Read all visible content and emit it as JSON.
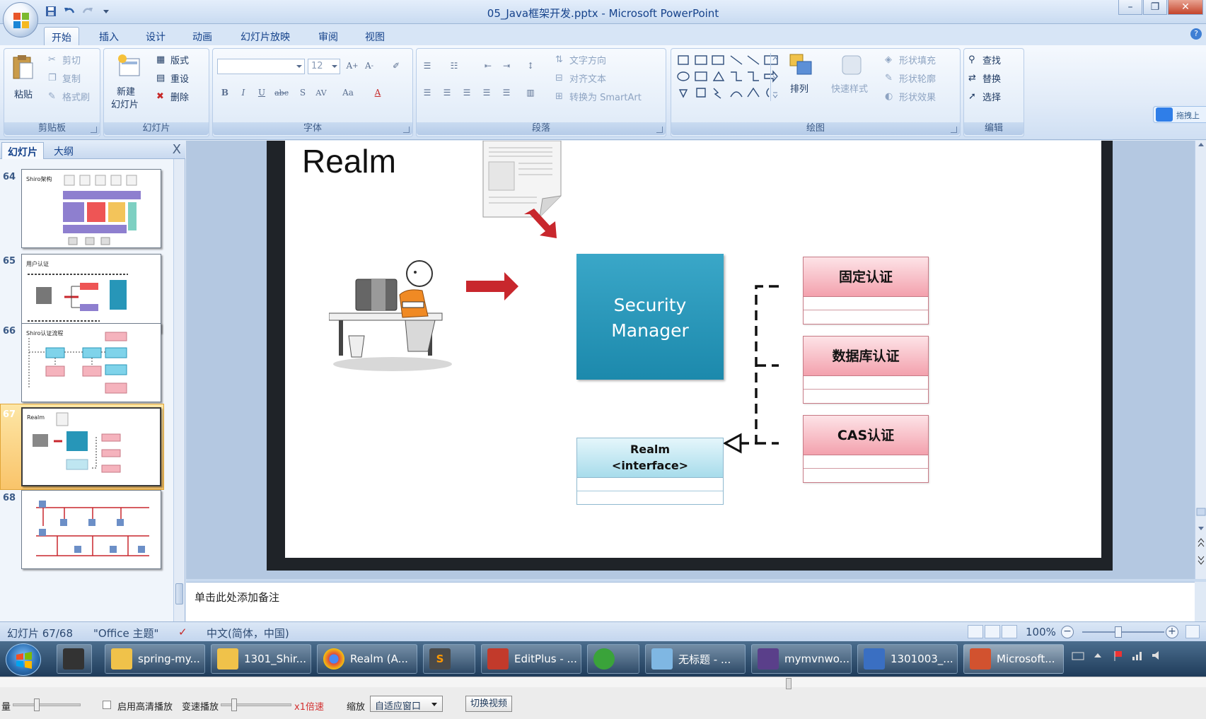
{
  "window": {
    "title": "05_Java框架开发.pptx - Microsoft PowerPoint"
  },
  "ribbon_tabs": [
    "开始",
    "插入",
    "设计",
    "动画",
    "幻灯片放映",
    "审阅",
    "视图"
  ],
  "clipboard": {
    "paste": "粘贴",
    "cut": "剪切",
    "copy": "复制",
    "format_painter": "格式刷",
    "label": "剪贴板"
  },
  "slides_group": {
    "new_slide_line1": "新建",
    "new_slide_line2": "幻灯片",
    "layout": "版式",
    "reset": "重设",
    "delete": "删除",
    "label": "幻灯片"
  },
  "font_group": {
    "font_size": "12",
    "label": "字体"
  },
  "paragraph_group": {
    "text_direction": "文字方向",
    "align_text": "对齐文本",
    "convert_smartart": "转换为 SmartArt",
    "label": "段落"
  },
  "drawing_group": {
    "arrange": "排列",
    "quick_styles": "快速样式",
    "shape_fill": "形状填充",
    "shape_outline": "形状轮廓",
    "shape_effects": "形状效果",
    "label": "绘图"
  },
  "editing_group": {
    "find": "查找",
    "replace": "替换",
    "select": "选择",
    "label": "编辑"
  },
  "side_badge": "拖拽上",
  "left_panel": {
    "tab_slides": "幻灯片",
    "tab_outline": "大纲",
    "close": "X",
    "thumbnails": [
      {
        "num": "64",
        "title": "Shiro架构"
      },
      {
        "num": "65",
        "title": "用户认证"
      },
      {
        "num": "66",
        "title": "Shiro认证流程"
      },
      {
        "num": "67",
        "title": "Realm"
      },
      {
        "num": "68",
        "title": ""
      }
    ]
  },
  "slide": {
    "title": "Realm",
    "security_manager_line1": "Security",
    "security_manager_line2": "Manager",
    "realm_line1": "Realm",
    "realm_line2": "<interface>",
    "auth_boxes": [
      "固定认证",
      "数据库认证",
      "CAS认证"
    ]
  },
  "notes": {
    "placeholder": "单击此处添加备注"
  },
  "statusbar": {
    "slide_counter": "幻灯片 67/68",
    "theme": "\"Office 主题\"",
    "language": "中文(简体，中国)",
    "zoom": "100%"
  },
  "taskbar": {
    "items": [
      {
        "label": "spring-my...",
        "color": "#f0c24a"
      },
      {
        "label": "1301_Shir...",
        "color": "#f0c24a"
      },
      {
        "label": "Realm (A...",
        "color": "#e0493d"
      },
      {
        "label": "",
        "color": "#4a4a4a"
      },
      {
        "label": "EditPlus - ...",
        "color": "#c23a2b"
      },
      {
        "label": "",
        "color": "#3aa33a"
      },
      {
        "label": "无标题 - ...",
        "color": "#7fb7e3"
      },
      {
        "label": "mymvnwo...",
        "color": "#5a3f8a"
      },
      {
        "label": "1301003_...",
        "color": "#3a6fc2"
      },
      {
        "label": "Microsoft...",
        "color": "#d2522f"
      }
    ]
  },
  "player": {
    "volume_label": "量",
    "hd_label": "启用高清播放",
    "speed_label": "变速播放",
    "speed_value": "x1倍速",
    "zoom_label": "缩放",
    "zoom_value": "自适应窗口",
    "switch_video": "切换视频"
  },
  "colors": {
    "security_manager": "#2796b8",
    "auth_header": "#f5b3bd",
    "realm_header": "#bfe6f1",
    "arrow_red": "#c8272d"
  }
}
